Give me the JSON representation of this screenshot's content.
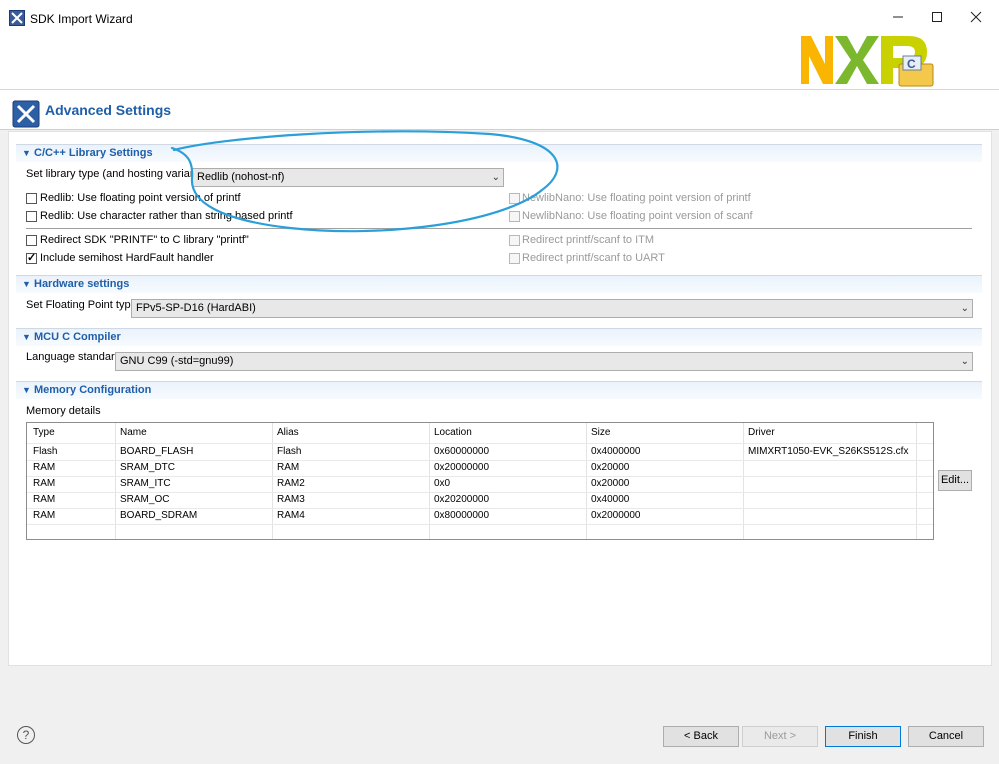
{
  "window": {
    "title": "SDK Import Wizard",
    "minimize": "—",
    "maximize": "☐",
    "close": "✕"
  },
  "header": {
    "title": "Advanced Settings"
  },
  "sections": {
    "library": {
      "title": "C/C++ Library Settings"
    },
    "hardware": {
      "title": "Hardware settings"
    },
    "compiler": {
      "title": "MCU C Compiler"
    },
    "memory": {
      "title": "Memory Configuration"
    }
  },
  "library": {
    "type_label": "Set library type (and hosting variant)",
    "type_value": "Redlib (nohost-nf)",
    "checks": [
      {
        "label": "Redlib: Use floating point version of printf",
        "checked": false,
        "enabled": true
      },
      {
        "label": "Redlib: Use character rather than string based printf",
        "checked": false,
        "enabled": true
      },
      {
        "label": "Redirect SDK \"PRINTF\" to C library \"printf\"",
        "checked": false,
        "enabled": true
      },
      {
        "label": "Include semihost HardFault handler",
        "checked": true,
        "enabled": true
      },
      {
        "label": "NewlibNano: Use floating point version of printf",
        "checked": false,
        "enabled": false
      },
      {
        "label": "NewlibNano: Use floating point version of scanf",
        "checked": false,
        "enabled": false
      },
      {
        "label": "Redirect printf/scanf to ITM",
        "checked": false,
        "enabled": false
      },
      {
        "label": "Redirect printf/scanf to UART",
        "checked": false,
        "enabled": false
      }
    ]
  },
  "hardware": {
    "fp_label": "Set Floating Point type",
    "fp_value": "FPv5-SP-D16 (HardABI)"
  },
  "compiler": {
    "lang_label": "Language standard",
    "lang_value": "GNU C99 (-std=gnu99)"
  },
  "memory": {
    "details_label": "Memory details",
    "columns": [
      "Type",
      "Name",
      "Alias",
      "Location",
      "Size",
      "Driver"
    ],
    "rows": [
      [
        "Flash",
        "BOARD_FLASH",
        "Flash",
        "0x60000000",
        "0x4000000",
        "MIMXRT1050-EVK_S26KS512S.cfx"
      ],
      [
        "RAM",
        "SRAM_DTC",
        "RAM",
        "0x20000000",
        "0x20000",
        ""
      ],
      [
        "RAM",
        "SRAM_ITC",
        "RAM2",
        "0x0",
        "0x20000",
        ""
      ],
      [
        "RAM",
        "SRAM_OC",
        "RAM3",
        "0x20200000",
        "0x40000",
        ""
      ],
      [
        "RAM",
        "BOARD_SDRAM",
        "RAM4",
        "0x80000000",
        "0x2000000",
        ""
      ]
    ],
    "edit_label": "Edit..."
  },
  "footer": {
    "help": "?",
    "back": "< Back",
    "next": "Next >",
    "finish": "Finish",
    "cancel": "Cancel"
  },
  "logo": {
    "text": "NXP",
    "colors": [
      "#f9b500",
      "#7bb82d",
      "#c9d200"
    ]
  },
  "colors": {
    "accent": "#1f5ea8",
    "annotation": "#2b9fd9"
  }
}
